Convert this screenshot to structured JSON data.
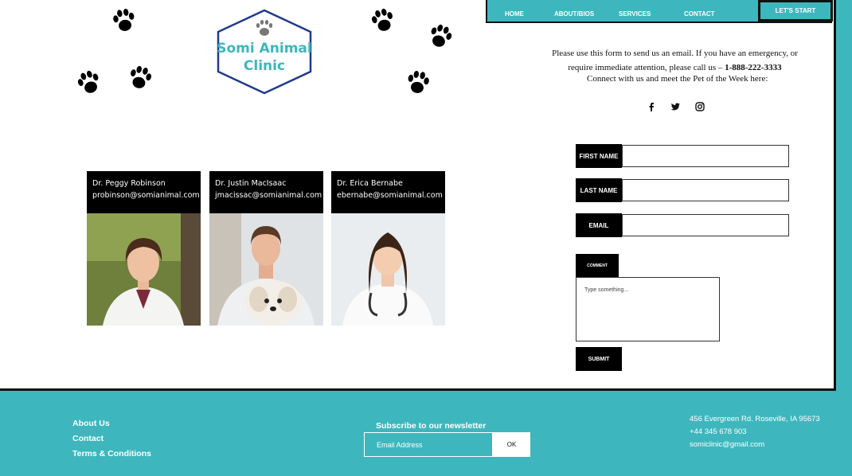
{
  "nav": {
    "items": [
      "HOME",
      "ABOUT/BIOS",
      "SERVICES",
      "CONTACT"
    ],
    "cta": "LET'S START"
  },
  "logo": {
    "line1": "Somi Animal",
    "line2": "Clinic"
  },
  "doctors": [
    {
      "name": "Dr. Peggy Robinson",
      "email": "probinson@somianimal.com"
    },
    {
      "name": "Dr. Justin MacIsaac",
      "email": "jmacissac@somianimal.com"
    },
    {
      "name": "Dr. Erica Bernabe",
      "email": "ebernabe@somianimal.com"
    }
  ],
  "contact": {
    "intro_line1": "Please use this form to send us an email. If you have an emergency, or",
    "intro_line2": "require immediate attention, please call us –",
    "phone": "1-888-222-3333",
    "connect": "Connect with us and meet the Pet of the Week here:",
    "social": [
      "facebook-icon",
      "twitter-icon",
      "instagram-icon"
    ]
  },
  "form": {
    "first_name_label": "FIRST NAME",
    "last_name_label": "LAST NAME",
    "email_label": "EMAIL",
    "comment_label": "COMMENT",
    "comment_placeholder": "Type something...",
    "submit_label": "SUBMIT"
  },
  "footer": {
    "links": [
      "About Us",
      "Contact",
      "Terms & Conditions"
    ],
    "newsletter_title": "Subscribe to our newsletter",
    "newsletter_placeholder": "Email Address",
    "newsletter_button": "OK",
    "address": "456 Evergreen Rd. Roseville, IA 95673",
    "phone": "+44 345 678 903",
    "email": "somiclinic@gmail.com"
  },
  "colors": {
    "accent": "#3db7bd",
    "dark": "#000000",
    "logo_navy": "#1f3a8a"
  }
}
